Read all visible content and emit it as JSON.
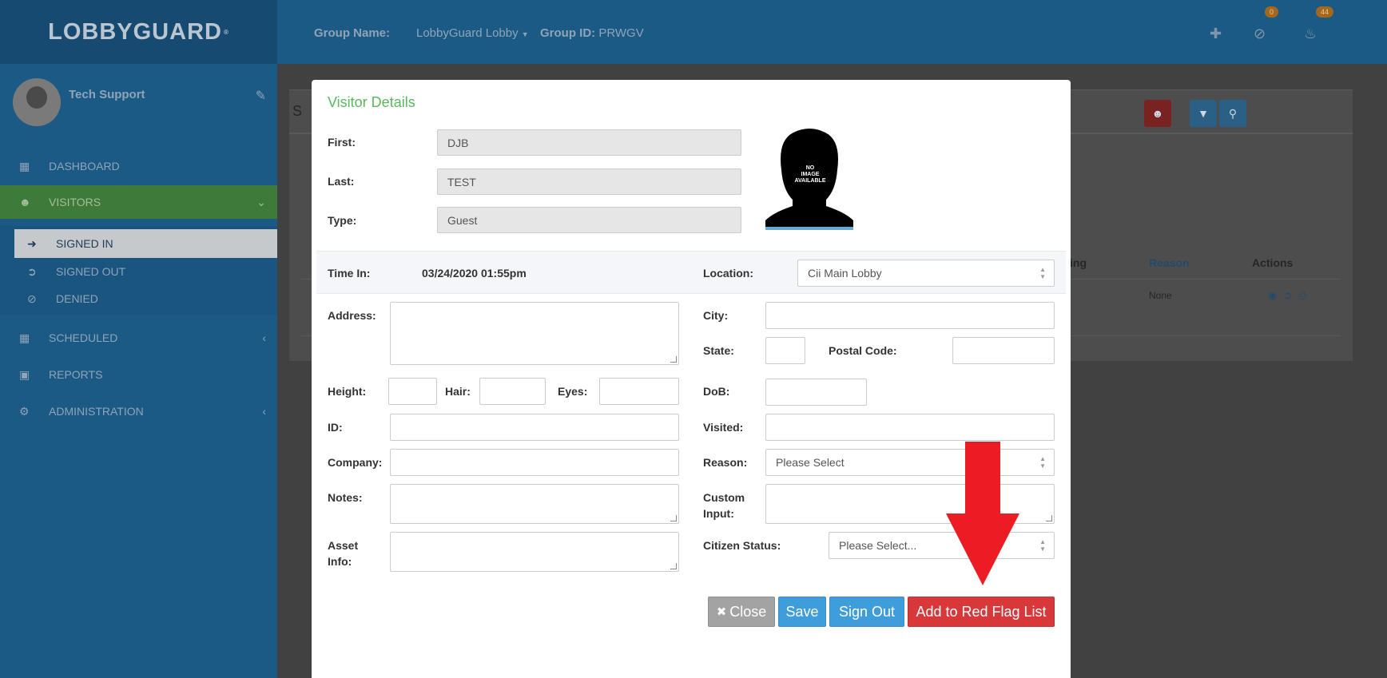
{
  "brand": {
    "name": "LOBBYGUARD",
    "mark": "®"
  },
  "header": {
    "group_name_label": "Group Name:",
    "group_name_value": "LobbyGuard Lobby",
    "group_id_label": "Group ID:",
    "group_id_value": "PRWGV",
    "badge_denied": "0",
    "badge_notifications": "44",
    "icons": [
      "add-user-icon",
      "ban-icon",
      "bell-icon"
    ]
  },
  "sidebar": {
    "user": "Tech Support",
    "items": [
      {
        "label": "DASHBOARD",
        "icon": "bar-chart-icon"
      },
      {
        "label": "VISITORS",
        "icon": "users-icon"
      },
      {
        "label": "SCHEDULED",
        "icon": "calendar-icon"
      },
      {
        "label": "REPORTS",
        "icon": "briefcase-icon"
      },
      {
        "label": "ADMINISTRATION",
        "icon": "cogs-icon"
      }
    ],
    "subitems": [
      {
        "label": "SIGNED IN",
        "icon": "sign-in-icon"
      },
      {
        "label": "SIGNED OUT",
        "icon": "sign-out-icon"
      },
      {
        "label": "DENIED",
        "icon": "ban-icon"
      }
    ]
  },
  "background_table": {
    "title_fragment": "S",
    "headers": [
      "ing",
      "Reason",
      "Actions"
    ],
    "row": {
      "reason": "None"
    }
  },
  "modal": {
    "title": "Visitor Details",
    "first_label": "First:",
    "first_value": "DJB",
    "last_label": "Last:",
    "last_value": "TEST",
    "type_label": "Type:",
    "type_value": "Guest",
    "photo_text": [
      "NO",
      "IMAGE",
      "AVAILABLE"
    ],
    "time_in_label": "Time In:",
    "time_in_value": "03/24/2020 01:55pm",
    "location_label": "Location:",
    "location_value": "Cii Main Lobby",
    "address_label": "Address:",
    "city_label": "City:",
    "state_label": "State:",
    "postal_label": "Postal Code:",
    "height_label": "Height:",
    "hair_label": "Hair:",
    "eyes_label": "Eyes:",
    "dob_label": "DoB:",
    "id_label": "ID:",
    "visited_label": "Visited:",
    "company_label": "Company:",
    "reason_label": "Reason:",
    "reason_value": "Please Select",
    "notes_label": "Notes:",
    "custom_label_1": "Custom",
    "custom_label_2": "Input:",
    "asset_label_1": "Asset",
    "asset_label_2": "Info:",
    "citizen_label": "Citizen Status:",
    "citizen_value": "Please Select...",
    "buttons": {
      "close": "Close",
      "close_icon": "✖",
      "save": "Save",
      "sign_out": "Sign Out",
      "red_flag": "Add to Red Flag List"
    }
  },
  "colors": {
    "overlay_arrow": "#ec1c24",
    "title_green": "#5cb85c",
    "primary": "#3f9ddb",
    "danger": "#d9383a"
  }
}
